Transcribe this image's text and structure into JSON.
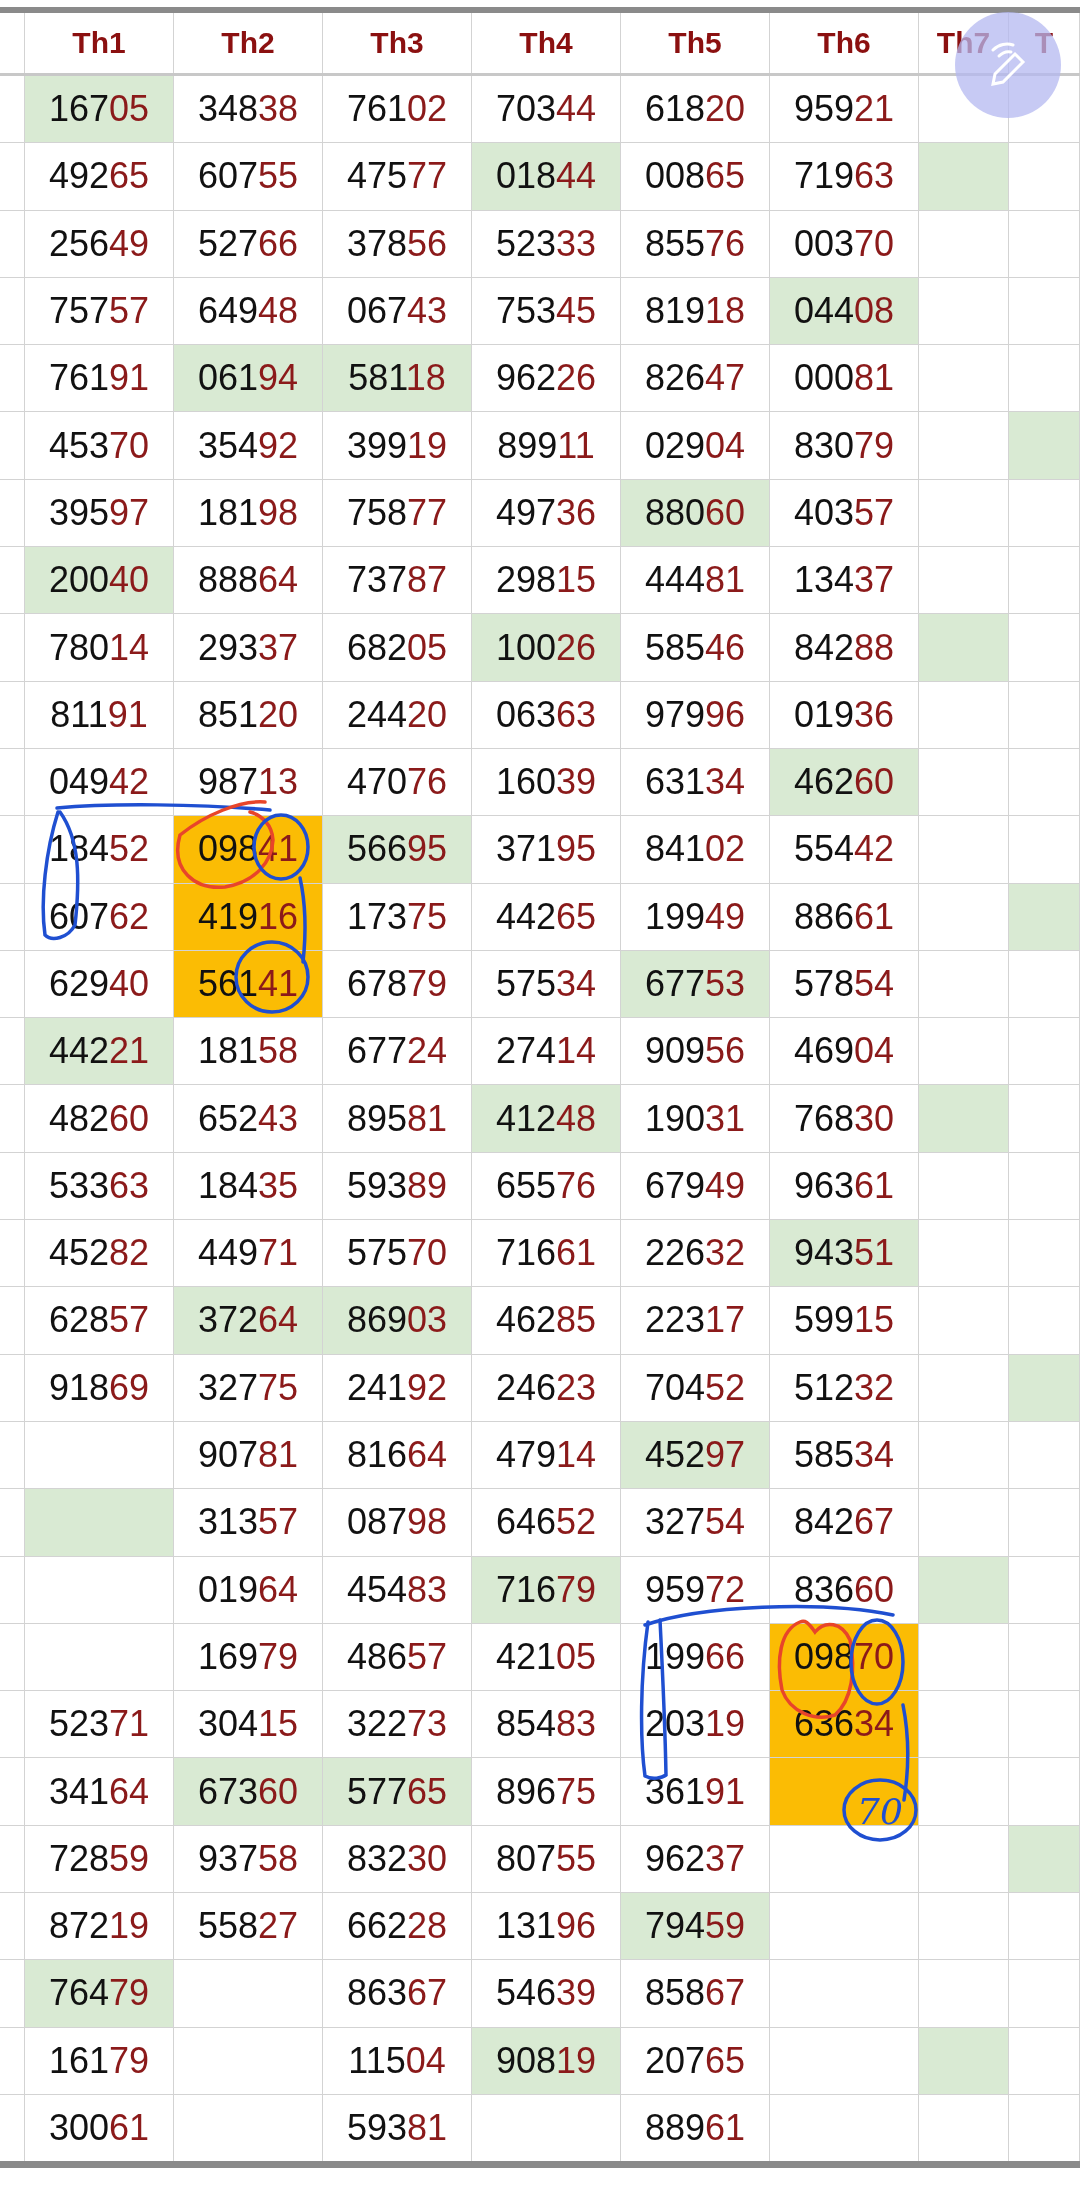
{
  "columns": [
    "Th1",
    "Th2",
    "Th3",
    "Th4",
    "Th5",
    "Th6",
    "Th7",
    "T"
  ],
  "rows": [
    {
      "cells": [
        {
          "value": "16705",
          "color": "#d9ead3"
        },
        {
          "value": "34838"
        },
        {
          "value": "76102"
        },
        {
          "value": "70344"
        },
        {
          "value": "61820"
        },
        {
          "value": "95921"
        },
        {},
        {}
      ]
    },
    {
      "cells": [
        {
          "value": "49265"
        },
        {
          "value": "60755"
        },
        {
          "value": "47577"
        },
        {
          "value": "01844",
          "color": "#d9ead3"
        },
        {
          "value": "00865"
        },
        {
          "value": "71963"
        },
        {
          "color": "#d9ead3"
        },
        {}
      ]
    },
    {
      "cells": [
        {
          "value": "25649"
        },
        {
          "value": "52766"
        },
        {
          "value": "37856"
        },
        {
          "value": "52333"
        },
        {
          "value": "85576"
        },
        {
          "value": "00370"
        },
        {},
        {}
      ]
    },
    {
      "cells": [
        {
          "value": "75757"
        },
        {
          "value": "64948"
        },
        {
          "value": "06743"
        },
        {
          "value": "75345"
        },
        {
          "value": "81918"
        },
        {
          "value": "04408",
          "color": "#d9ead3"
        },
        {},
        {}
      ]
    },
    {
      "cells": [
        {
          "value": "76191"
        },
        {
          "value": "06194",
          "color": "#d9ead3"
        },
        {
          "value": "58118",
          "color": "#d9ead3"
        },
        {
          "value": "96226"
        },
        {
          "value": "82647"
        },
        {
          "value": "00081"
        },
        {},
        {}
      ]
    },
    {
      "cells": [
        {
          "value": "45370"
        },
        {
          "value": "35492"
        },
        {
          "value": "39919"
        },
        {
          "value": "89911"
        },
        {
          "value": "02904"
        },
        {
          "value": "83079"
        },
        {},
        {
          "color": "#d9ead3"
        }
      ]
    },
    {
      "cells": [
        {
          "value": "39597"
        },
        {
          "value": "18198"
        },
        {
          "value": "75877"
        },
        {
          "value": "49736"
        },
        {
          "value": "88060",
          "color": "#d9ead3"
        },
        {
          "value": "40357"
        },
        {},
        {}
      ]
    },
    {
      "cells": [
        {
          "value": "20040",
          "color": "#d9ead3"
        },
        {
          "value": "88864"
        },
        {
          "value": "73787"
        },
        {
          "value": "29815"
        },
        {
          "value": "44481"
        },
        {
          "value": "13437"
        },
        {},
        {}
      ]
    },
    {
      "cells": [
        {
          "value": "78014"
        },
        {
          "value": "29337"
        },
        {
          "value": "68205"
        },
        {
          "value": "10026",
          "color": "#d9ead3"
        },
        {
          "value": "58546"
        },
        {
          "value": "84288"
        },
        {
          "color": "#d9ead3"
        },
        {}
      ]
    },
    {
      "cells": [
        {
          "value": "81191"
        },
        {
          "value": "85120"
        },
        {
          "value": "24420"
        },
        {
          "value": "06363"
        },
        {
          "value": "97996"
        },
        {
          "value": "01936"
        },
        {},
        {}
      ]
    },
    {
      "cells": [
        {
          "value": "04942"
        },
        {
          "value": "98713"
        },
        {
          "value": "47076"
        },
        {
          "value": "16039"
        },
        {
          "value": "63134"
        },
        {
          "value": "46260",
          "color": "#d9ead3"
        },
        {},
        {}
      ]
    },
    {
      "cells": [
        {
          "value": "18452"
        },
        {
          "value": "09841",
          "color": "#fbbc04"
        },
        {
          "value": "56695",
          "color": "#d9ead3"
        },
        {
          "value": "37195"
        },
        {
          "value": "84102"
        },
        {
          "value": "55442"
        },
        {},
        {}
      ]
    },
    {
      "cells": [
        {
          "value": "60762"
        },
        {
          "value": "41916",
          "color": "#fbbc04"
        },
        {
          "value": "17375"
        },
        {
          "value": "44265"
        },
        {
          "value": "19949"
        },
        {
          "value": "88661"
        },
        {},
        {
          "color": "#d9ead3"
        }
      ]
    },
    {
      "cells": [
        {
          "value": "62940"
        },
        {
          "value": "56141",
          "color": "#fbbc04"
        },
        {
          "value": "67879"
        },
        {
          "value": "57534"
        },
        {
          "value": "67753",
          "color": "#d9ead3"
        },
        {
          "value": "57854"
        },
        {},
        {}
      ]
    },
    {
      "cells": [
        {
          "value": "44221",
          "color": "#d9ead3"
        },
        {
          "value": "18158"
        },
        {
          "value": "67724"
        },
        {
          "value": "27414"
        },
        {
          "value": "90956"
        },
        {
          "value": "46904"
        },
        {},
        {}
      ]
    },
    {
      "cells": [
        {
          "value": "48260"
        },
        {
          "value": "65243"
        },
        {
          "value": "89581"
        },
        {
          "value": "41248",
          "color": "#d9ead3"
        },
        {
          "value": "19031"
        },
        {
          "value": "76830"
        },
        {
          "color": "#d9ead3"
        },
        {}
      ]
    },
    {
      "cells": [
        {
          "value": "53363"
        },
        {
          "value": "18435"
        },
        {
          "value": "59389"
        },
        {
          "value": "65576"
        },
        {
          "value": "67949"
        },
        {
          "value": "96361"
        },
        {},
        {}
      ]
    },
    {
      "cells": [
        {
          "value": "45282"
        },
        {
          "value": "44971"
        },
        {
          "value": "57570"
        },
        {
          "value": "71661"
        },
        {
          "value": "22632"
        },
        {
          "value": "94351",
          "color": "#d9ead3"
        },
        {},
        {}
      ]
    },
    {
      "cells": [
        {
          "value": "62857"
        },
        {
          "value": "37264",
          "color": "#d9ead3"
        },
        {
          "value": "86903",
          "color": "#d9ead3"
        },
        {
          "value": "46285"
        },
        {
          "value": "22317"
        },
        {
          "value": "59915"
        },
        {},
        {}
      ]
    },
    {
      "cells": [
        {
          "value": "91869"
        },
        {
          "value": "32775"
        },
        {
          "value": "24192"
        },
        {
          "value": "24623"
        },
        {
          "value": "70452"
        },
        {
          "value": "51232"
        },
        {},
        {
          "color": "#d9ead3"
        }
      ]
    },
    {
      "cells": [
        {},
        {
          "value": "90781"
        },
        {
          "value": "81664"
        },
        {
          "value": "47914"
        },
        {
          "value": "45297",
          "color": "#d9ead3"
        },
        {
          "value": "58534"
        },
        {},
        {}
      ]
    },
    {
      "cells": [
        {
          "color": "#d9ead3"
        },
        {
          "value": "31357"
        },
        {
          "value": "08798"
        },
        {
          "value": "64652"
        },
        {
          "value": "32754"
        },
        {
          "value": "84267"
        },
        {},
        {}
      ]
    },
    {
      "cells": [
        {},
        {
          "value": "01964"
        },
        {
          "value": "45483"
        },
        {
          "value": "71679",
          "color": "#d9ead3"
        },
        {
          "value": "95972"
        },
        {
          "value": "83660"
        },
        {
          "color": "#d9ead3"
        },
        {}
      ]
    },
    {
      "cells": [
        {},
        {
          "value": "16979"
        },
        {
          "value": "48657"
        },
        {
          "value": "42105"
        },
        {
          "value": "19966"
        },
        {
          "value": "09870",
          "color": "#fbbc04"
        },
        {},
        {}
      ]
    },
    {
      "cells": [
        {
          "value": "52371"
        },
        {
          "value": "30415"
        },
        {
          "value": "32273"
        },
        {
          "value": "85483"
        },
        {
          "value": "20319"
        },
        {
          "value": "63634",
          "color": "#fbbc04"
        },
        {},
        {}
      ]
    },
    {
      "cells": [
        {
          "value": "34164"
        },
        {
          "value": "67360",
          "color": "#d9ead3"
        },
        {
          "value": "57765",
          "color": "#d9ead3"
        },
        {
          "value": "89675"
        },
        {
          "value": "36191"
        },
        {
          "color": "#fbbc04"
        },
        {},
        {}
      ]
    },
    {
      "cells": [
        {
          "value": "72859"
        },
        {
          "value": "93758"
        },
        {
          "value": "83230"
        },
        {
          "value": "80755"
        },
        {
          "value": "96237"
        },
        {},
        {},
        {
          "color": "#d9ead3"
        }
      ]
    },
    {
      "cells": [
        {
          "value": "87219"
        },
        {
          "value": "55827"
        },
        {
          "value": "66228"
        },
        {
          "value": "13196"
        },
        {
          "value": "79459",
          "color": "#d9ead3"
        },
        {},
        {},
        {}
      ]
    },
    {
      "cells": [
        {
          "value": "76479",
          "color": "#d9ead3"
        },
        {},
        {
          "value": "86367"
        },
        {
          "value": "54639"
        },
        {
          "value": "85867"
        },
        {},
        {},
        {}
      ]
    },
    {
      "cells": [
        {
          "value": "16179"
        },
        {},
        {
          "value": "11504"
        },
        {
          "value": "90819",
          "color": "#d9ead3"
        },
        {
          "value": "20765"
        },
        {},
        {
          "color": "#d9ead3"
        },
        {}
      ]
    },
    {
      "cells": [
        {
          "value": "30061"
        },
        {},
        {
          "value": "59381"
        },
        {},
        {
          "value": "88961"
        },
        {},
        {},
        {}
      ]
    }
  ],
  "annotation_note": "70"
}
